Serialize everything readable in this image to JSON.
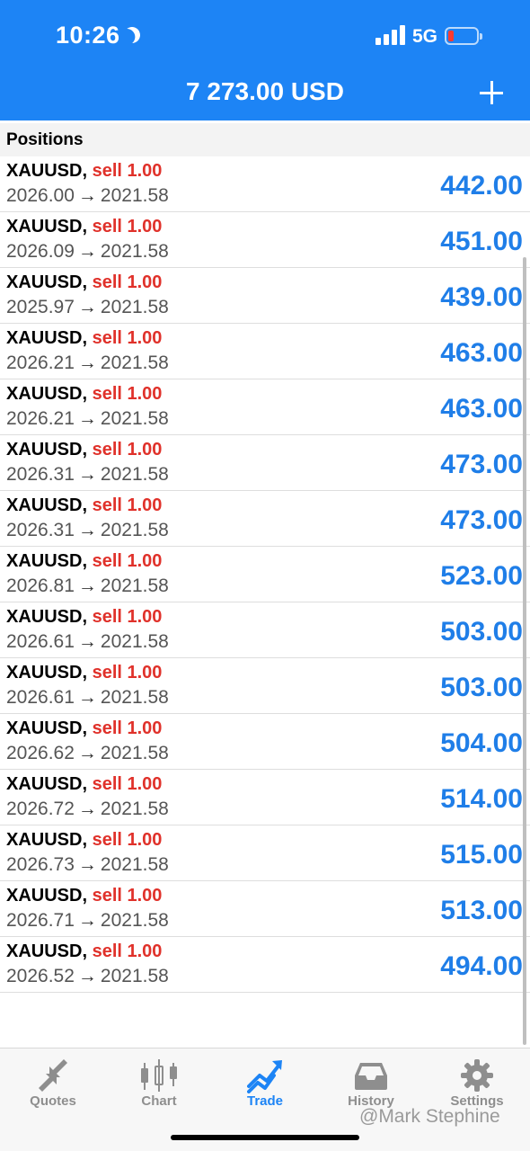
{
  "status_bar": {
    "time": "10:26",
    "network": "5G"
  },
  "header": {
    "balance": "7 273.00 USD"
  },
  "section": {
    "title": "Positions"
  },
  "positions": [
    {
      "symbol": "XAUUSD,",
      "direction": "sell 1.00",
      "open": "2026.00",
      "current": "2021.58",
      "profit": "442.00"
    },
    {
      "symbol": "XAUUSD,",
      "direction": "sell 1.00",
      "open": "2026.09",
      "current": "2021.58",
      "profit": "451.00"
    },
    {
      "symbol": "XAUUSD,",
      "direction": "sell 1.00",
      "open": "2025.97",
      "current": "2021.58",
      "profit": "439.00"
    },
    {
      "symbol": "XAUUSD,",
      "direction": "sell 1.00",
      "open": "2026.21",
      "current": "2021.58",
      "profit": "463.00"
    },
    {
      "symbol": "XAUUSD,",
      "direction": "sell 1.00",
      "open": "2026.21",
      "current": "2021.58",
      "profit": "463.00"
    },
    {
      "symbol": "XAUUSD,",
      "direction": "sell 1.00",
      "open": "2026.31",
      "current": "2021.58",
      "profit": "473.00"
    },
    {
      "symbol": "XAUUSD,",
      "direction": "sell 1.00",
      "open": "2026.31",
      "current": "2021.58",
      "profit": "473.00"
    },
    {
      "symbol": "XAUUSD,",
      "direction": "sell 1.00",
      "open": "2026.81",
      "current": "2021.58",
      "profit": "523.00"
    },
    {
      "symbol": "XAUUSD,",
      "direction": "sell 1.00",
      "open": "2026.61",
      "current": "2021.58",
      "profit": "503.00"
    },
    {
      "symbol": "XAUUSD,",
      "direction": "sell 1.00",
      "open": "2026.61",
      "current": "2021.58",
      "profit": "503.00"
    },
    {
      "symbol": "XAUUSD,",
      "direction": "sell 1.00",
      "open": "2026.62",
      "current": "2021.58",
      "profit": "504.00"
    },
    {
      "symbol": "XAUUSD,",
      "direction": "sell 1.00",
      "open": "2026.72",
      "current": "2021.58",
      "profit": "514.00"
    },
    {
      "symbol": "XAUUSD,",
      "direction": "sell 1.00",
      "open": "2026.73",
      "current": "2021.58",
      "profit": "515.00"
    },
    {
      "symbol": "XAUUSD,",
      "direction": "sell 1.00",
      "open": "2026.71",
      "current": "2021.58",
      "profit": "513.00"
    },
    {
      "symbol": "XAUUSD,",
      "direction": "sell 1.00",
      "open": "2026.52",
      "current": "2021.58",
      "profit": "494.00"
    }
  ],
  "tabs": [
    {
      "label": "Quotes",
      "icon": "quotes-icon",
      "active": false
    },
    {
      "label": "Chart",
      "icon": "chart-icon",
      "active": false
    },
    {
      "label": "Trade",
      "icon": "trade-icon",
      "active": true
    },
    {
      "label": "History",
      "icon": "history-icon",
      "active": false
    },
    {
      "label": "Settings",
      "icon": "gear-icon",
      "active": false
    }
  ],
  "watermark": "@Mark Stephine",
  "colors": {
    "accent": "#1d84f5",
    "sell": "#e0312a",
    "profit": "#1f7ee8",
    "inactive_tab": "#8e8e8e"
  }
}
